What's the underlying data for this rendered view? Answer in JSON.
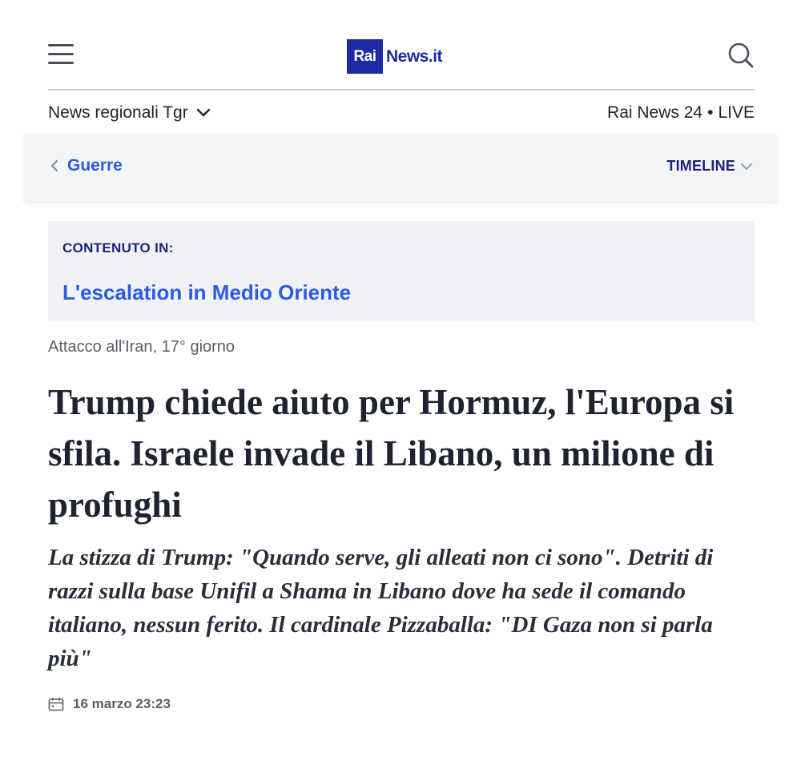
{
  "header": {
    "logo_box": "Rai",
    "logo_text": "News.it",
    "brand_color": "#1c2ba4"
  },
  "subnav": {
    "regional_label": "News regionali Tgr",
    "live_channel": "Rai News 24",
    "live_separator": "•",
    "live_label": "LIVE"
  },
  "section_bar": {
    "back_label": "Guerre",
    "timeline_label": "TIMELINE"
  },
  "content_in": {
    "label": "CONTENUTO IN:",
    "link": "L'escalation in Medio Oriente"
  },
  "article": {
    "kicker": "Attacco all'Iran, 17° giorno",
    "headline": "Trump chiede aiuto per Hormuz, l'Europa si sfila. Israele invade il Libano, un milione di profughi",
    "subtitle": "La stizza di Trump: \"Quando serve, gli alleati non ci sono\". Detriti di razzi sulla base Unifil a Shama in Libano dove ha sede il comando italiano, nessun ferito. Il cardinale Pizzaballa: \"DI Gaza non si parla più\"",
    "date": "16 marzo 23:23"
  },
  "icons": {
    "menu": "hamburger-menu-icon",
    "search": "search-icon",
    "chevron_down": "chevron-down-icon",
    "chevron_left": "chevron-left-icon",
    "calendar": "calendar-icon"
  },
  "colors": {
    "link_blue": "#2d5be3",
    "navy": "#1c2475",
    "text": "#1f2230",
    "muted": "#5a5d6a"
  }
}
